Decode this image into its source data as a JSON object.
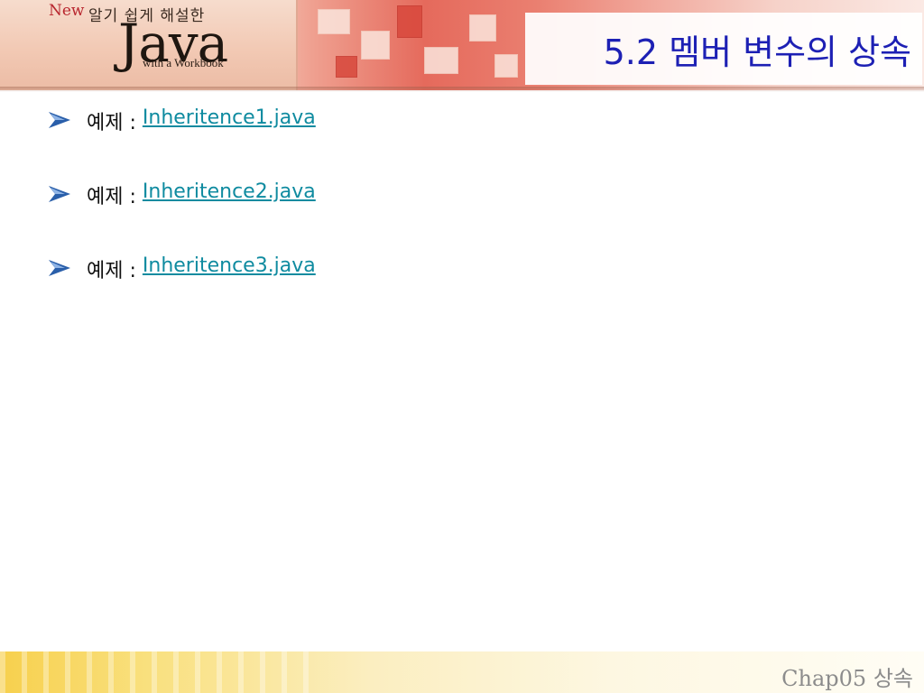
{
  "header": {
    "logo": {
      "new_text": "New",
      "tagline": "알기 쉽게 해설한",
      "wordmark": "Java",
      "subtitle": "with a Workbook"
    },
    "title": "5.2 멤버 변수의 상속"
  },
  "content": {
    "items": [
      {
        "prefix": "예제 : ",
        "link_text": "Inheritence1.java"
      },
      {
        "prefix": "예제 : ",
        "link_text": "Inheritence2.java"
      },
      {
        "prefix": "예제 : ",
        "link_text": "Inheritence3.java"
      }
    ]
  },
  "footer": {
    "label": "Chap05 상속"
  },
  "colors": {
    "title": "#1d20b4",
    "link": "#0f8ba0",
    "footer_text": "#8c8c8c",
    "arrow": "#2a5faa"
  }
}
